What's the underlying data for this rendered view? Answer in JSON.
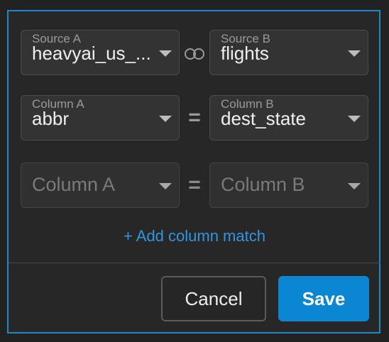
{
  "row1": {
    "left": {
      "label": "Source A",
      "value": "heavyai_us_..."
    },
    "right": {
      "label": "Source B",
      "value": "flights"
    },
    "join_icon": "join-rings-icon"
  },
  "row2": {
    "left": {
      "label": "Column A",
      "value": "abbr"
    },
    "operator": "=",
    "right": {
      "label": "Column B",
      "value": "dest_state"
    }
  },
  "row3": {
    "left": {
      "placeholder": "Column A"
    },
    "operator": "=",
    "right": {
      "placeholder": "Column B"
    }
  },
  "add_column_match": "+ Add column match",
  "buttons": {
    "cancel": "Cancel",
    "save": "Save"
  },
  "colors": {
    "accent": "#0a86d2",
    "border": "#1e88c8",
    "link": "#2f97de"
  }
}
